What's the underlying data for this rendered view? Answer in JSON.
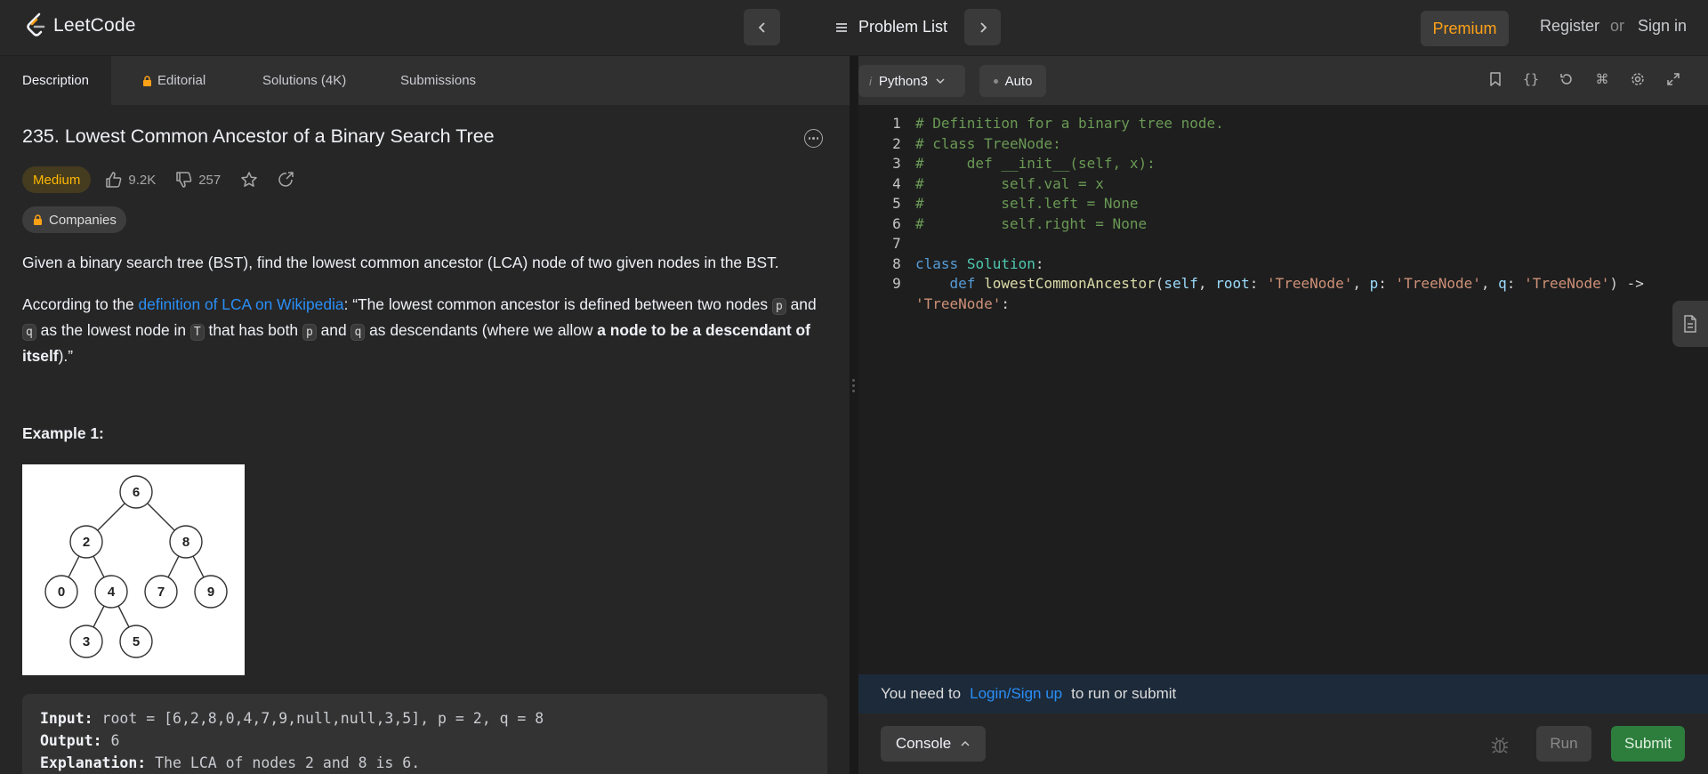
{
  "brand": {
    "name": "LeetCode"
  },
  "nav": {
    "problem_list": "Problem List",
    "premium": "Premium",
    "register": "Register",
    "or": "or",
    "sign_in": "Sign in"
  },
  "left_tabs": {
    "description": "Description",
    "editorial": "Editorial",
    "solutions": "Solutions (4K)",
    "submissions": "Submissions"
  },
  "problem": {
    "title": "235. Lowest Common Ancestor of a Binary Search Tree",
    "difficulty": "Medium",
    "likes": "9.2K",
    "dislikes": "257",
    "companies": "Companies",
    "para1": "Given a binary search tree (BST), find the lowest common ancestor (LCA) node of two given nodes in the BST.",
    "para2_a": "According to the ",
    "para2_link": "definition of LCA on Wikipedia",
    "para2_b": ": “The lowest common ancestor is defined between two nodes ",
    "code_p": "p",
    "para2_c": " and ",
    "code_q": "q",
    "para2_d": " as the lowest node in ",
    "code_T": "T",
    "para2_e": " that has both ",
    "para2_f": " and ",
    "para2_g": " as descendants (where we allow ",
    "para2_bold": "a node to be a descendant of itself",
    "para2_h": ").”",
    "example_title": "Example 1:",
    "tree_nodes": [
      "6",
      "2",
      "8",
      "0",
      "4",
      "7",
      "9",
      "3",
      "5"
    ],
    "example": {
      "input_label": "Input:",
      "input_value": " root = [6,2,8,0,4,7,9,null,null,3,5], p = 2, q = 8",
      "output_label": "Output:",
      "output_value": " 6",
      "explanation_label": "Explanation:",
      "explanation_value": " The LCA of nodes 2 and 8 is 6."
    }
  },
  "editor": {
    "language": "Python3",
    "mode": "Auto",
    "lines": [
      {
        "n": "1",
        "text": "# Definition for a binary tree node."
      },
      {
        "n": "2",
        "text": "# class TreeNode:"
      },
      {
        "n": "3",
        "text": "#     def __init__(self, x):"
      },
      {
        "n": "4",
        "text": "#         self.val = x"
      },
      {
        "n": "5",
        "text": "#         self.left = None"
      },
      {
        "n": "6",
        "text": "#         self.right = None"
      },
      {
        "n": "7",
        "text": ""
      },
      {
        "n": "8",
        "text": "class Solution:"
      },
      {
        "n": "9",
        "text": "    def lowestCommonAncestor(self, root: 'TreeNode', p: 'TreeNode', q: 'TreeNode') ->"
      },
      {
        "n": "",
        "text": "'TreeNode':"
      }
    ]
  },
  "login_bar": {
    "prefix": "You need to",
    "link": "Login/Sign up",
    "suffix": "to run or submit"
  },
  "bottom": {
    "console": "Console",
    "run": "Run",
    "submit": "Submit"
  },
  "colors": {
    "accent_premium": "#ffa116",
    "medium": "#ffb800",
    "link": "#2a8ff7",
    "submit": "#2d7e3d"
  }
}
